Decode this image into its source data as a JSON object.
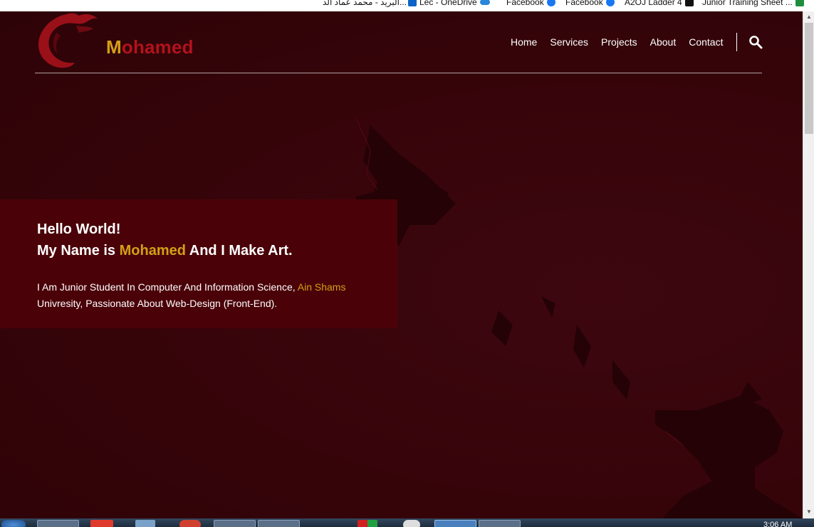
{
  "bookmarks": [
    {
      "label": "البريد - محمد عماد الد...",
      "icon": "mail-icon",
      "color": "#ffffff"
    },
    {
      "label": "Lec - OneDrive",
      "icon": "outlook-icon",
      "color": "#0a64c8"
    },
    {
      "label": "Facebook",
      "icon": "facebook-icon",
      "color": "#1877f2"
    },
    {
      "label": "Facebook",
      "icon": "facebook-icon",
      "color": "#1877f2"
    },
    {
      "label": "A2OJ Ladder 4",
      "icon": "a2oj-icon",
      "color": "#111111"
    },
    {
      "label": "Junior Training Sheet ...",
      "icon": "sheets-icon",
      "color": "#1e8e3e"
    }
  ],
  "header": {
    "brand_first": "M",
    "brand_rest": "ohamed",
    "nav": [
      "Home",
      "Services",
      "Projects",
      "About",
      "Contact"
    ],
    "search_icon": "search-icon"
  },
  "hero": {
    "line1": "Hello World!",
    "line2_prefix": "My Name is ",
    "line2_name": "Mohamed",
    "line2_suffix": " And I Make Art.",
    "desc_prefix": "I Am Junior Student In Computer And Information Science, ",
    "desc_accent": "Ain Shams",
    "desc_suffix": " Univresity, Passionate About Web-Design (Front-End)."
  },
  "taskbar": {
    "clock": "3:06 AM"
  },
  "colors": {
    "accent": "#d4a017",
    "brand_red": "#b3121b",
    "hero_box": "#4a0208",
    "background": "#3a050c"
  }
}
